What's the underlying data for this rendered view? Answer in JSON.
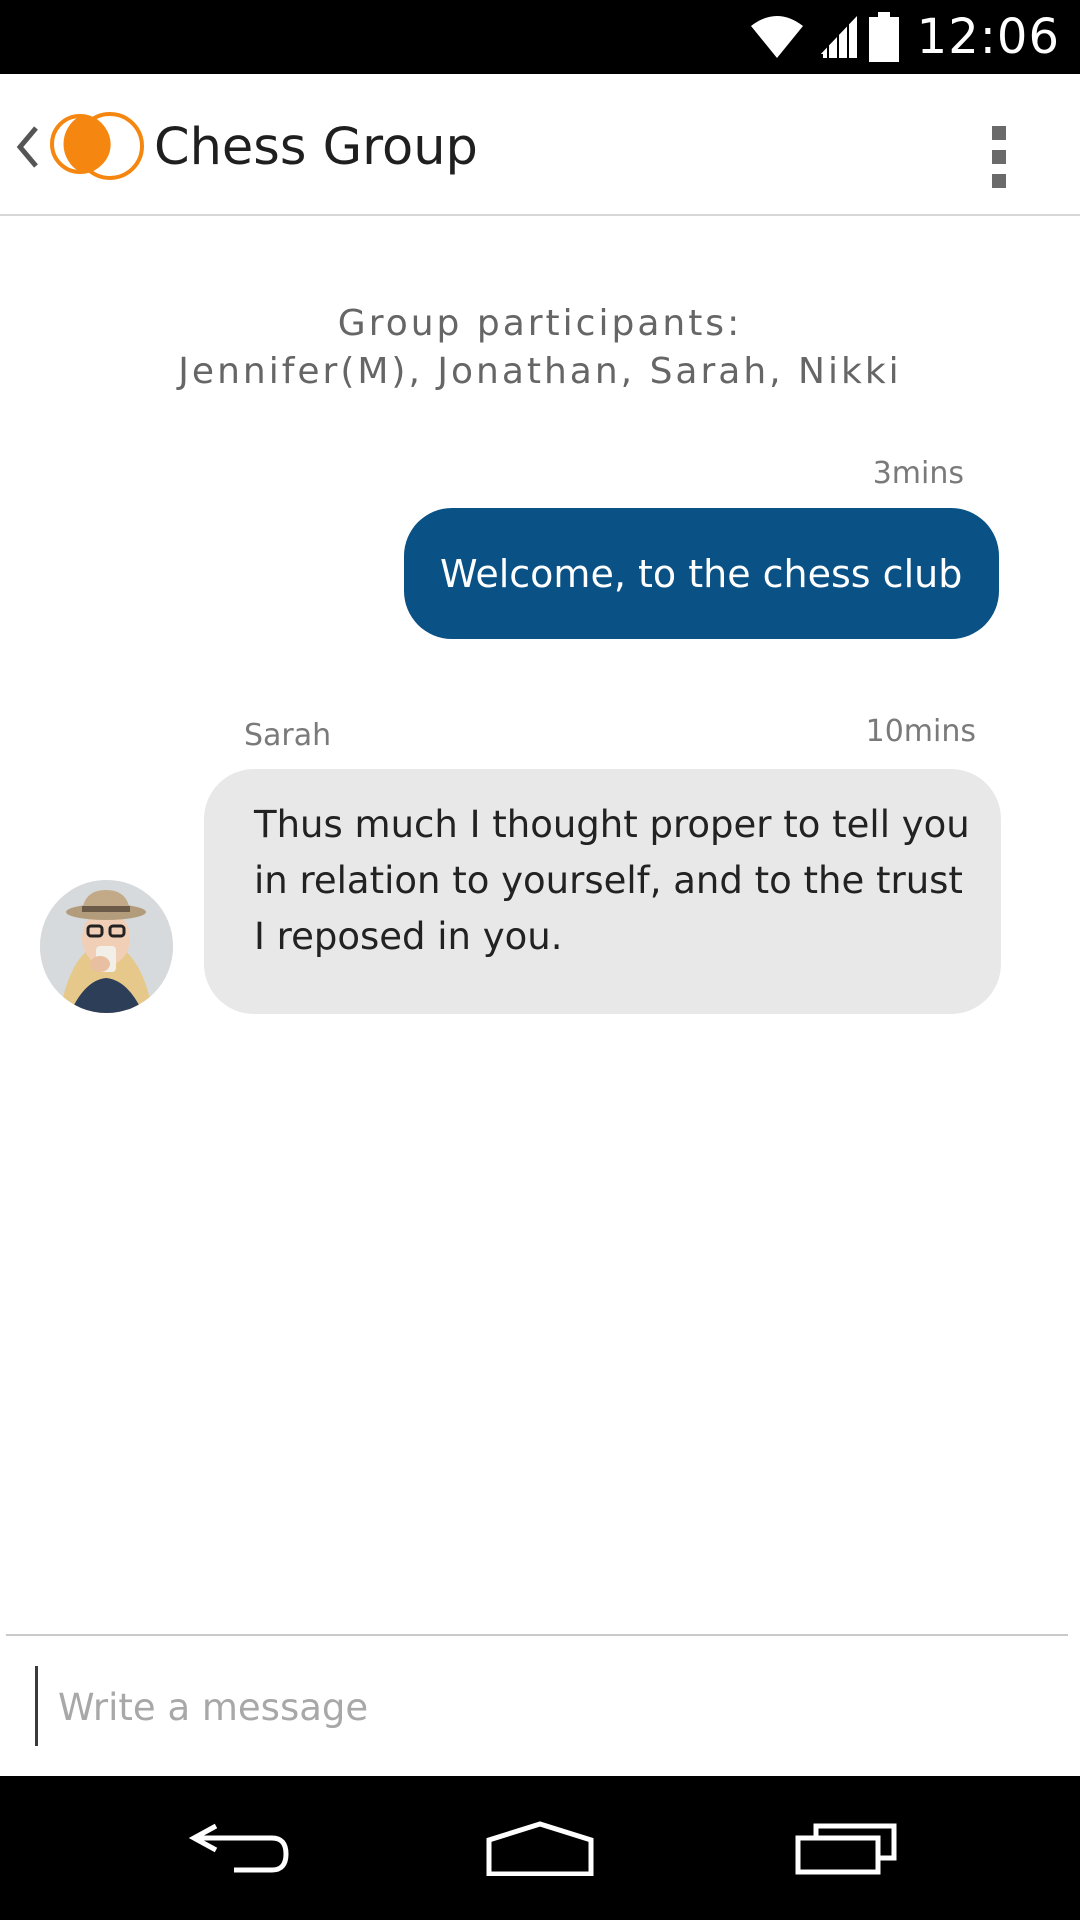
{
  "status_bar": {
    "time": "12:06",
    "icons": [
      "wifi-icon",
      "signal-icon",
      "battery-icon"
    ]
  },
  "header": {
    "title": "Chess Group",
    "back_icon": "chevron-left-icon",
    "logo_icon": "app-logo-icon",
    "overflow_icon": "more-vertical-icon"
  },
  "chat": {
    "participants_heading": "Group participants:",
    "participants_list": "Jennifer(M), Jonathan, Sarah, Nikki",
    "messages": [
      {
        "direction": "outgoing",
        "time": "3mins",
        "text": "Welcome, to the chess club"
      },
      {
        "direction": "incoming",
        "sender": "Sarah",
        "time": "10mins",
        "text": "Thus much I thought proper to tell you in relation to yourself, and to the trust I reposed in you."
      }
    ]
  },
  "composer": {
    "placeholder": "Write a message",
    "value": ""
  },
  "nav_bar": {
    "icons": [
      "back-nav-icon",
      "home-nav-icon",
      "recents-nav-icon"
    ]
  },
  "colors": {
    "outgoing_bubble": "#0a5185",
    "incoming_bubble": "#e8e8e8",
    "logo_orange": "#f5860f"
  }
}
